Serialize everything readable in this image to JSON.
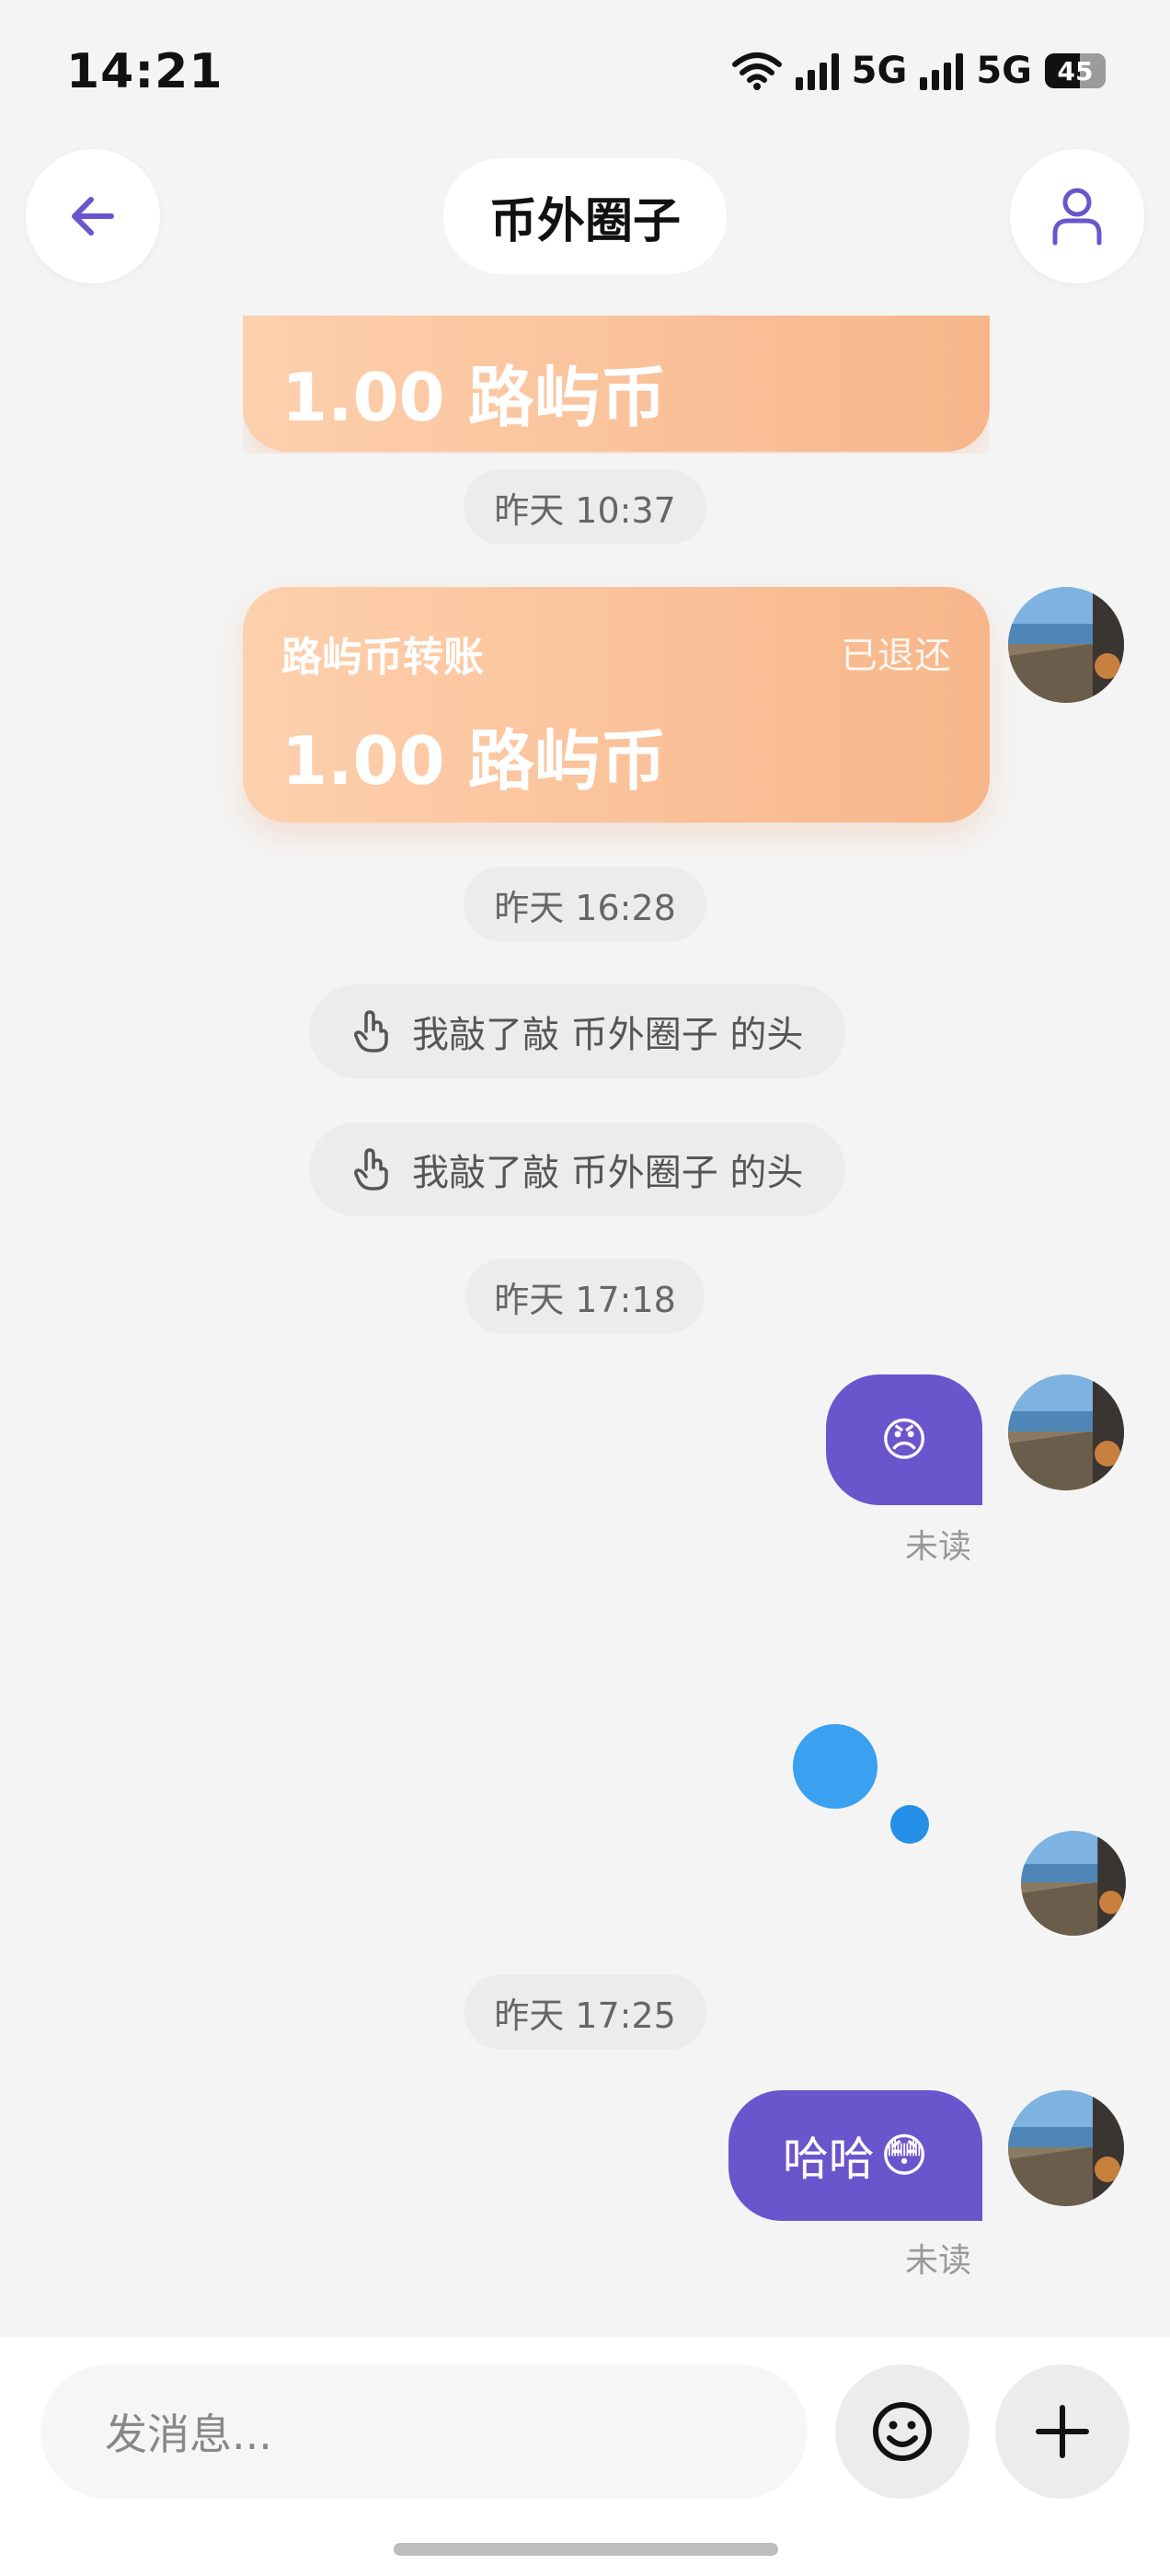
{
  "status_bar": {
    "time": "14:21",
    "network1": "5G",
    "network2": "5G",
    "battery": "45"
  },
  "header": {
    "title": "币外圈子"
  },
  "messages": {
    "partial_card": {
      "amount": "1.00 路屿币"
    },
    "time1": "昨天 10:37",
    "transfer_card": {
      "title": "路屿币转账",
      "status": "已退还",
      "amount": "1.00 路屿币"
    },
    "time2": "昨天 16:28",
    "poke1": "我敲了敲 币外圈子 的头",
    "poke2": "我敲了敲 币外圈子 的头",
    "time3": "昨天 17:18",
    "emoji_msg": {
      "emoji": "😠",
      "status": "未读"
    },
    "time4": "昨天 17:25",
    "text_msg": {
      "text": "哈哈",
      "emoji": "😳",
      "status": "未读"
    }
  },
  "composer": {
    "placeholder": "发消息..."
  },
  "colors": {
    "accent": "#6b55cc",
    "card_start": "#fdd0ad",
    "card_end": "#f7b68a",
    "typing_dot": "#3aa0f0"
  }
}
